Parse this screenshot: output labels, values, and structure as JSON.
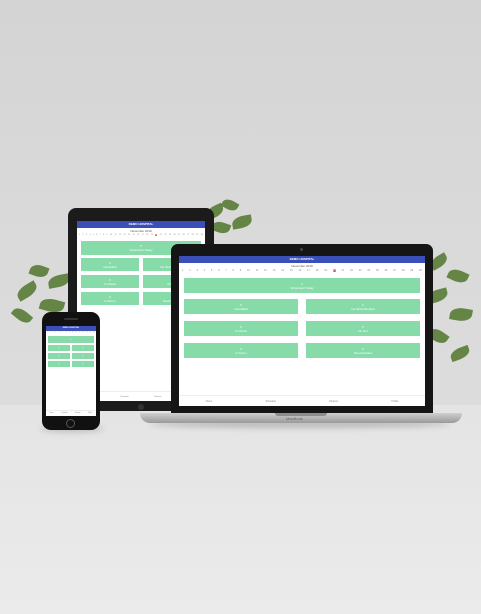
{
  "app": {
    "title": "DEMO HOSPITAL",
    "month": "November 2019",
    "days": [
      "1",
      "2",
      "3",
      "4",
      "5",
      "6",
      "7",
      "8",
      "9",
      "10",
      "11",
      "12",
      "13",
      "14",
      "15",
      "16",
      "17",
      "18",
      "19",
      "20",
      "21",
      "22",
      "23",
      "24",
      "25",
      "26",
      "27",
      "28",
      "29",
      "30"
    ],
    "selected_day": "20",
    "summary": {
      "count": "0",
      "label": "Scheduled Today"
    },
    "tiles": [
      {
        "count": "0",
        "label": "Cancelled"
      },
      {
        "count": "0",
        "label": "No Show Booked"
      },
      {
        "count": "0",
        "label": "In Check"
      },
      {
        "count": "0",
        "label": "Ch Out"
      },
      {
        "count": "0",
        "label": "In Room"
      },
      {
        "count": "0",
        "label": "Rescheduled"
      }
    ],
    "nav": [
      "Home",
      "Schedule",
      "Patients",
      "Profile"
    ]
  },
  "laptop_brand": "MacBook",
  "colors": {
    "appbar": "#3a4fb8",
    "tile": "#86dba9",
    "selected": "#e53935"
  }
}
